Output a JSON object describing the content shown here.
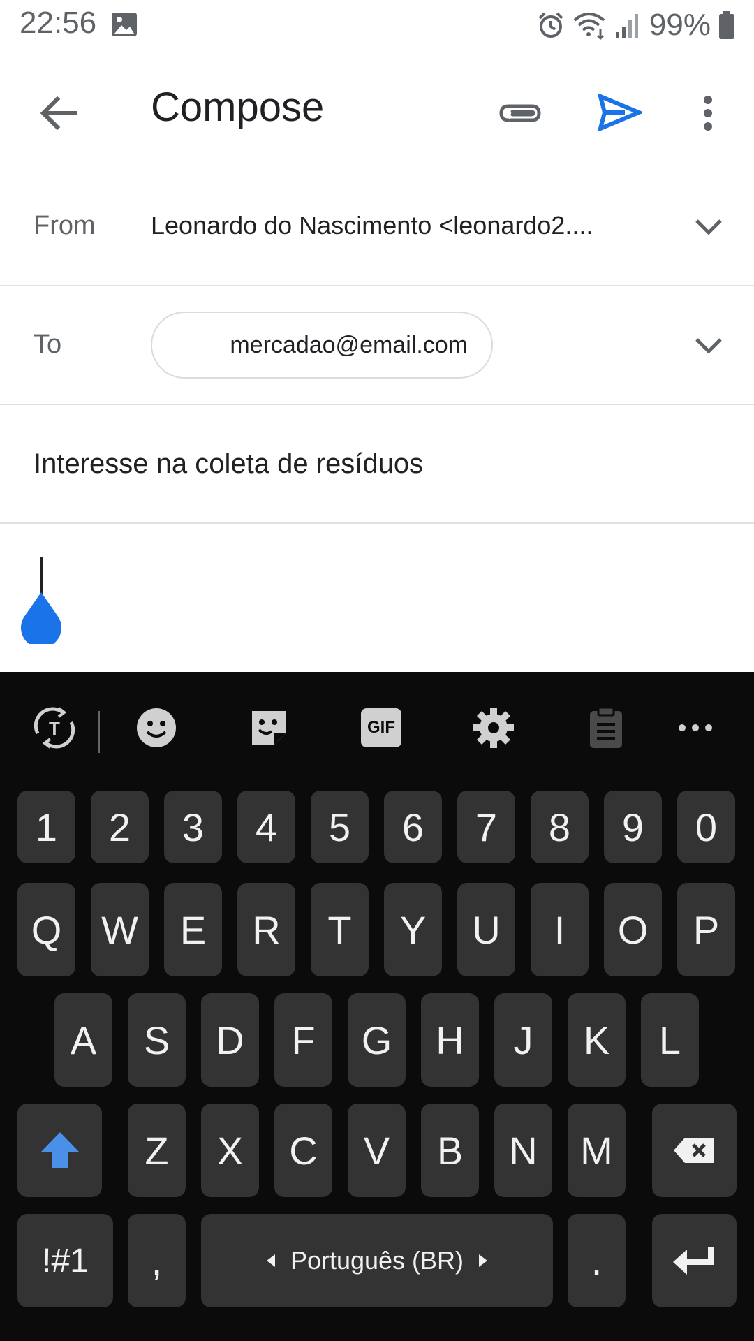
{
  "status_bar": {
    "time": "22:56",
    "battery_percent": "99%",
    "icons": [
      "image-icon",
      "alarm-icon",
      "wifi-icon",
      "signal-icon",
      "battery-icon"
    ]
  },
  "app_bar": {
    "title": "Compose",
    "accent_color": "#1a73e8",
    "icons": [
      "back-arrow-icon",
      "paperclip-icon",
      "send-icon",
      "more-vert-icon"
    ]
  },
  "fields": {
    "from_label": "From",
    "from_value": "Leonardo do Nascimento  <leonardo2....",
    "to_label": "To",
    "to_chip": "mercadao@email.com",
    "subject": "Interesse na coleta de resíduos"
  },
  "keyboard": {
    "toolbar_icons": [
      "translate-icon",
      "emoji-icon",
      "sticker-icon",
      "gif-icon",
      "settings-icon",
      "clipboard-icon",
      "more-horiz-icon"
    ],
    "gif_label": "GIF",
    "number_row": [
      "1",
      "2",
      "3",
      "4",
      "5",
      "6",
      "7",
      "8",
      "9",
      "0"
    ],
    "row1": [
      "Q",
      "W",
      "E",
      "R",
      "T",
      "Y",
      "U",
      "I",
      "O",
      "P"
    ],
    "row2": [
      "A",
      "S",
      "D",
      "F",
      "G",
      "H",
      "J",
      "K",
      "L"
    ],
    "row3": [
      "Z",
      "X",
      "C",
      "V",
      "B",
      "N",
      "M"
    ],
    "symbols_label": "!#1",
    "comma_label": ",",
    "space_label": "Português (BR)",
    "period_label": ".",
    "key_bg_color": "#333333",
    "keyboard_bg_color": "#0b0b0b"
  }
}
